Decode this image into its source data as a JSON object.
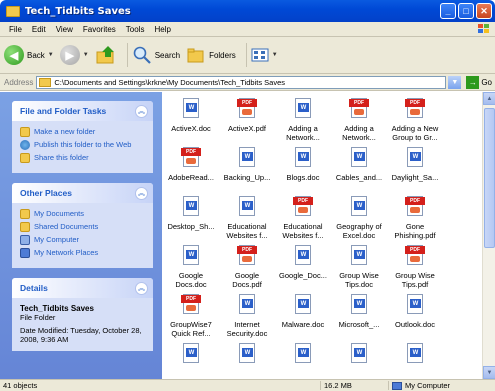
{
  "window": {
    "title": "Tech_Tidbits Saves"
  },
  "menu": [
    "File",
    "Edit",
    "View",
    "Favorites",
    "Tools",
    "Help"
  ],
  "toolbar": {
    "back": "Back",
    "search": "Search",
    "folders": "Folders"
  },
  "address": {
    "label": "Address",
    "path": "C:\\Documents and Settings\\krkne\\My Documents\\Tech_Tidbits Saves",
    "go": "Go"
  },
  "sidebar": {
    "tasks": {
      "title": "File and Folder Tasks",
      "items": [
        "Make a new folder",
        "Publish this folder to the Web",
        "Share this folder"
      ]
    },
    "places": {
      "title": "Other Places",
      "items": [
        "My Documents",
        "Shared Documents",
        "My Computer",
        "My Network Places"
      ]
    },
    "details": {
      "title": "Details",
      "name": "Tech_Tidbits Saves",
      "type": "File Folder",
      "modified": "Date Modified: Tuesday, October 28, 2008, 9:36 AM"
    }
  },
  "files": [
    {
      "name": "ActiveX.doc",
      "kind": "doc"
    },
    {
      "name": "ActiveX.pdf",
      "kind": "pdf"
    },
    {
      "name": "Adding a Network...",
      "kind": "doc"
    },
    {
      "name": "Adding a Network...",
      "kind": "pdf"
    },
    {
      "name": "Adding a New Group to Gr...",
      "kind": "pdf"
    },
    {
      "name": "AdobeRead...",
      "kind": "pdf"
    },
    {
      "name": "Backing_Up...",
      "kind": "doc"
    },
    {
      "name": "Blogs.doc",
      "kind": "doc"
    },
    {
      "name": "Cables_and...",
      "kind": "doc"
    },
    {
      "name": "Daylight_Sa...",
      "kind": "doc"
    },
    {
      "name": "Desktop_Sh...",
      "kind": "doc"
    },
    {
      "name": "Educational Websites f...",
      "kind": "doc"
    },
    {
      "name": "Educational Websites f...",
      "kind": "pdf"
    },
    {
      "name": "Geography of Excel.doc",
      "kind": "doc"
    },
    {
      "name": "Gone Phishing.pdf",
      "kind": "pdf"
    },
    {
      "name": "Google Docs.doc",
      "kind": "doc"
    },
    {
      "name": "Google Docs.pdf",
      "kind": "pdf"
    },
    {
      "name": "Google_Doc...",
      "kind": "doc"
    },
    {
      "name": "Group Wise Tips.doc",
      "kind": "doc"
    },
    {
      "name": "Group Wise Tips.pdf",
      "kind": "pdf"
    },
    {
      "name": "GroupWise7 Quick Ref...",
      "kind": "pdf"
    },
    {
      "name": "Internet Security.doc",
      "kind": "doc"
    },
    {
      "name": "Malware.doc",
      "kind": "doc"
    },
    {
      "name": "Microsoft_...",
      "kind": "doc"
    },
    {
      "name": "Outlook.doc",
      "kind": "doc"
    },
    {
      "name": "",
      "kind": "doc"
    },
    {
      "name": "",
      "kind": "doc"
    },
    {
      "name": "",
      "kind": "doc"
    },
    {
      "name": "",
      "kind": "doc"
    },
    {
      "name": "",
      "kind": "doc"
    }
  ],
  "status": {
    "count": "41 objects",
    "size": "16.2 MB",
    "location": "My Computer"
  },
  "colors": {
    "title_bar": "#0054e3",
    "sidebar": "#6d8fdb",
    "task_link": "#215dc6",
    "pdf_red": "#d4201b",
    "word_blue": "#2b5fc9"
  }
}
